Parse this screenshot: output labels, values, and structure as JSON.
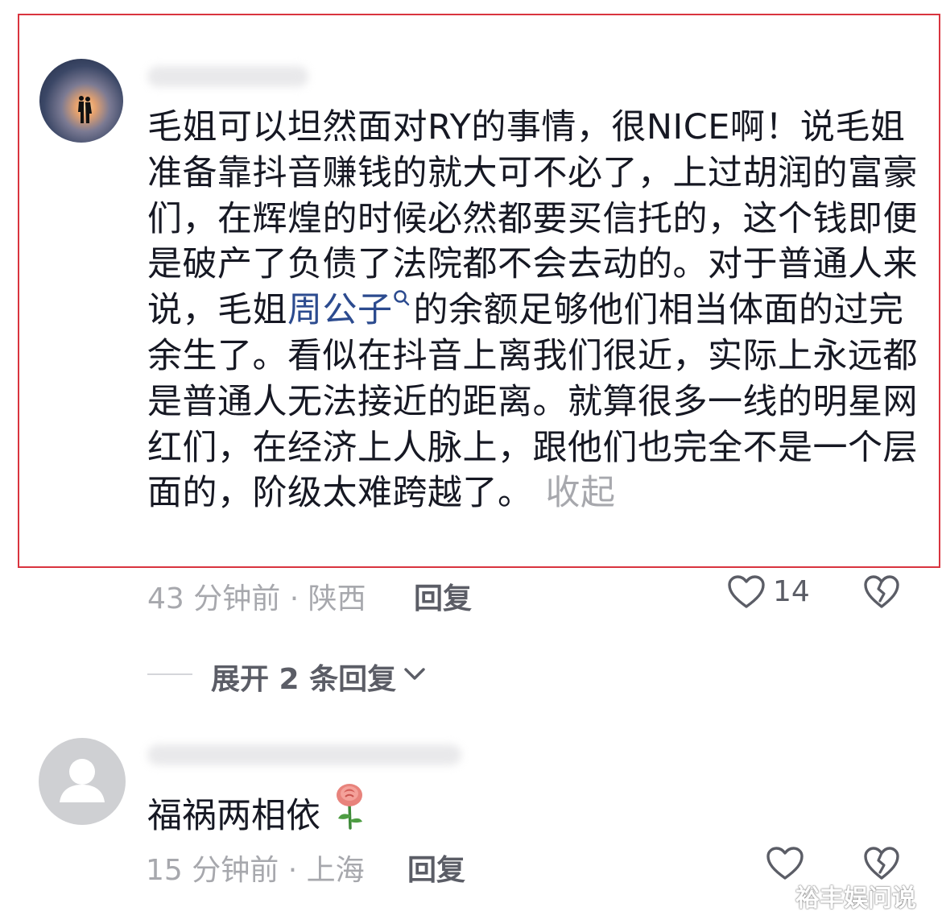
{
  "comments": [
    {
      "username": "",
      "text_before_mention": "毛姐可以坦然面对RY的事情，很NICE啊！说毛姐准备靠抖音赚钱的就大可不必了，上过胡润的富豪们，在辉煌的时候必然都要买信托的，这个钱即便是破产了负债了法院都不会去动的。对于普通人来说，毛姐",
      "mention": "周公子",
      "text_after_mention": "的余额足够他们相当体面的过完余生了。看似在抖音上离我们很近，实际上永远都是普通人无法接近的距离。就算很多一线的明星网红们，在经济上人脉上，跟他们也完全不是一个层面的，阶级太难跨越了。",
      "collapse_label": "收起",
      "meta": "43 分钟前 · 陕西",
      "reply_label": "回复",
      "like_count": "14",
      "highlighted": true
    },
    {
      "username": "",
      "text": "福祸两相依",
      "meta": "15 分钟前 · 上海",
      "reply_label": "回复",
      "like_count": ""
    }
  ],
  "expand_replies_label": "展开 2 条回复",
  "icons": {
    "like": "heart-outline-icon",
    "dislike": "broken-heart-icon",
    "mention_search": "search-icon",
    "expand": "chevron-down-icon",
    "emoji": "rose-emoji"
  },
  "colors": {
    "text": "#161823",
    "secondary": "#a7a8ad",
    "mention": "#2c4b8f",
    "highlight_border": "#d9343f"
  },
  "watermark": "裕丰娱问说"
}
